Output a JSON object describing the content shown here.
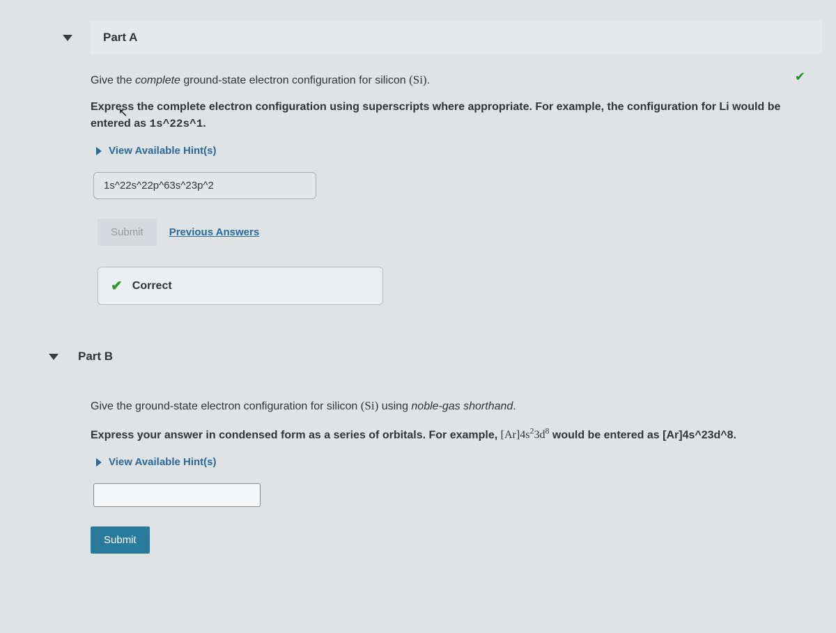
{
  "partA": {
    "title": "Part A",
    "question_prefix": "Give the ",
    "question_complete": "complete",
    "question_mid": " ground-state electron configuration for silicon ",
    "question_element": "(Si)",
    "question_end": ".",
    "instruction_prefix": "Express the complete electron configuration using superscripts where appropriate. For example, the configuration for Li would be entered as ",
    "instruction_code": "1s^22s^1",
    "instruction_end": ".",
    "hints_label": "View Available Hint(s)",
    "answer": "1s^22s^22p^63s^23p^2",
    "submit_label": "Submit",
    "previous_answers": "Previous Answers",
    "correct_label": "Correct"
  },
  "partB": {
    "title": "Part B",
    "question_prefix": "Give the ground-state electron configuration for silicon ",
    "question_element": "(Si)",
    "question_mid": " using ",
    "question_shorthand": "noble-gas shorthand",
    "question_end": ".",
    "instruction_prefix": "Express your answer in condensed form as a series of orbitals. For example, ",
    "instruction_formula_ar": "[Ar]",
    "instruction_formula_4s": "4s",
    "instruction_formula_4s_sup": "2",
    "instruction_formula_3d": "3d",
    "instruction_formula_3d_sup": "8",
    "instruction_mid": " would be entered as ",
    "instruction_code": "[Ar]4s^23d^8",
    "instruction_end": ".",
    "hints_label": "View Available Hint(s)",
    "answer": "",
    "submit_label": "Submit"
  }
}
